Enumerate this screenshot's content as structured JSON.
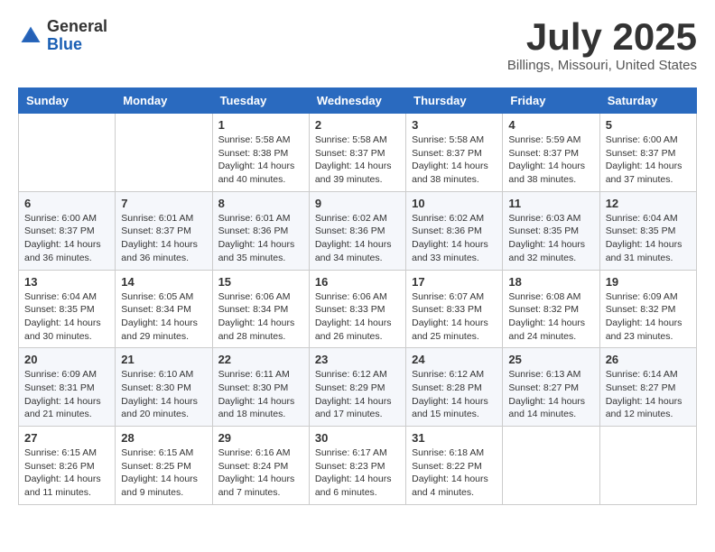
{
  "header": {
    "logo": {
      "general": "General",
      "blue": "Blue"
    },
    "title": "July 2025",
    "location": "Billings, Missouri, United States"
  },
  "weekdays": [
    "Sunday",
    "Monday",
    "Tuesday",
    "Wednesday",
    "Thursday",
    "Friday",
    "Saturday"
  ],
  "weeks": [
    [
      {
        "day": "",
        "sunrise": "",
        "sunset": "",
        "daylight": ""
      },
      {
        "day": "",
        "sunrise": "",
        "sunset": "",
        "daylight": ""
      },
      {
        "day": "1",
        "sunrise": "Sunrise: 5:58 AM",
        "sunset": "Sunset: 8:38 PM",
        "daylight": "Daylight: 14 hours and 40 minutes."
      },
      {
        "day": "2",
        "sunrise": "Sunrise: 5:58 AM",
        "sunset": "Sunset: 8:37 PM",
        "daylight": "Daylight: 14 hours and 39 minutes."
      },
      {
        "day": "3",
        "sunrise": "Sunrise: 5:58 AM",
        "sunset": "Sunset: 8:37 PM",
        "daylight": "Daylight: 14 hours and 38 minutes."
      },
      {
        "day": "4",
        "sunrise": "Sunrise: 5:59 AM",
        "sunset": "Sunset: 8:37 PM",
        "daylight": "Daylight: 14 hours and 38 minutes."
      },
      {
        "day": "5",
        "sunrise": "Sunrise: 6:00 AM",
        "sunset": "Sunset: 8:37 PM",
        "daylight": "Daylight: 14 hours and 37 minutes."
      }
    ],
    [
      {
        "day": "6",
        "sunrise": "Sunrise: 6:00 AM",
        "sunset": "Sunset: 8:37 PM",
        "daylight": "Daylight: 14 hours and 36 minutes."
      },
      {
        "day": "7",
        "sunrise": "Sunrise: 6:01 AM",
        "sunset": "Sunset: 8:37 PM",
        "daylight": "Daylight: 14 hours and 36 minutes."
      },
      {
        "day": "8",
        "sunrise": "Sunrise: 6:01 AM",
        "sunset": "Sunset: 8:36 PM",
        "daylight": "Daylight: 14 hours and 35 minutes."
      },
      {
        "day": "9",
        "sunrise": "Sunrise: 6:02 AM",
        "sunset": "Sunset: 8:36 PM",
        "daylight": "Daylight: 14 hours and 34 minutes."
      },
      {
        "day": "10",
        "sunrise": "Sunrise: 6:02 AM",
        "sunset": "Sunset: 8:36 PM",
        "daylight": "Daylight: 14 hours and 33 minutes."
      },
      {
        "day": "11",
        "sunrise": "Sunrise: 6:03 AM",
        "sunset": "Sunset: 8:35 PM",
        "daylight": "Daylight: 14 hours and 32 minutes."
      },
      {
        "day": "12",
        "sunrise": "Sunrise: 6:04 AM",
        "sunset": "Sunset: 8:35 PM",
        "daylight": "Daylight: 14 hours and 31 minutes."
      }
    ],
    [
      {
        "day": "13",
        "sunrise": "Sunrise: 6:04 AM",
        "sunset": "Sunset: 8:35 PM",
        "daylight": "Daylight: 14 hours and 30 minutes."
      },
      {
        "day": "14",
        "sunrise": "Sunrise: 6:05 AM",
        "sunset": "Sunset: 8:34 PM",
        "daylight": "Daylight: 14 hours and 29 minutes."
      },
      {
        "day": "15",
        "sunrise": "Sunrise: 6:06 AM",
        "sunset": "Sunset: 8:34 PM",
        "daylight": "Daylight: 14 hours and 28 minutes."
      },
      {
        "day": "16",
        "sunrise": "Sunrise: 6:06 AM",
        "sunset": "Sunset: 8:33 PM",
        "daylight": "Daylight: 14 hours and 26 minutes."
      },
      {
        "day": "17",
        "sunrise": "Sunrise: 6:07 AM",
        "sunset": "Sunset: 8:33 PM",
        "daylight": "Daylight: 14 hours and 25 minutes."
      },
      {
        "day": "18",
        "sunrise": "Sunrise: 6:08 AM",
        "sunset": "Sunset: 8:32 PM",
        "daylight": "Daylight: 14 hours and 24 minutes."
      },
      {
        "day": "19",
        "sunrise": "Sunrise: 6:09 AM",
        "sunset": "Sunset: 8:32 PM",
        "daylight": "Daylight: 14 hours and 23 minutes."
      }
    ],
    [
      {
        "day": "20",
        "sunrise": "Sunrise: 6:09 AM",
        "sunset": "Sunset: 8:31 PM",
        "daylight": "Daylight: 14 hours and 21 minutes."
      },
      {
        "day": "21",
        "sunrise": "Sunrise: 6:10 AM",
        "sunset": "Sunset: 8:30 PM",
        "daylight": "Daylight: 14 hours and 20 minutes."
      },
      {
        "day": "22",
        "sunrise": "Sunrise: 6:11 AM",
        "sunset": "Sunset: 8:30 PM",
        "daylight": "Daylight: 14 hours and 18 minutes."
      },
      {
        "day": "23",
        "sunrise": "Sunrise: 6:12 AM",
        "sunset": "Sunset: 8:29 PM",
        "daylight": "Daylight: 14 hours and 17 minutes."
      },
      {
        "day": "24",
        "sunrise": "Sunrise: 6:12 AM",
        "sunset": "Sunset: 8:28 PM",
        "daylight": "Daylight: 14 hours and 15 minutes."
      },
      {
        "day": "25",
        "sunrise": "Sunrise: 6:13 AM",
        "sunset": "Sunset: 8:27 PM",
        "daylight": "Daylight: 14 hours and 14 minutes."
      },
      {
        "day": "26",
        "sunrise": "Sunrise: 6:14 AM",
        "sunset": "Sunset: 8:27 PM",
        "daylight": "Daylight: 14 hours and 12 minutes."
      }
    ],
    [
      {
        "day": "27",
        "sunrise": "Sunrise: 6:15 AM",
        "sunset": "Sunset: 8:26 PM",
        "daylight": "Daylight: 14 hours and 11 minutes."
      },
      {
        "day": "28",
        "sunrise": "Sunrise: 6:15 AM",
        "sunset": "Sunset: 8:25 PM",
        "daylight": "Daylight: 14 hours and 9 minutes."
      },
      {
        "day": "29",
        "sunrise": "Sunrise: 6:16 AM",
        "sunset": "Sunset: 8:24 PM",
        "daylight": "Daylight: 14 hours and 7 minutes."
      },
      {
        "day": "30",
        "sunrise": "Sunrise: 6:17 AM",
        "sunset": "Sunset: 8:23 PM",
        "daylight": "Daylight: 14 hours and 6 minutes."
      },
      {
        "day": "31",
        "sunrise": "Sunrise: 6:18 AM",
        "sunset": "Sunset: 8:22 PM",
        "daylight": "Daylight: 14 hours and 4 minutes."
      },
      {
        "day": "",
        "sunrise": "",
        "sunset": "",
        "daylight": ""
      },
      {
        "day": "",
        "sunrise": "",
        "sunset": "",
        "daylight": ""
      }
    ]
  ]
}
